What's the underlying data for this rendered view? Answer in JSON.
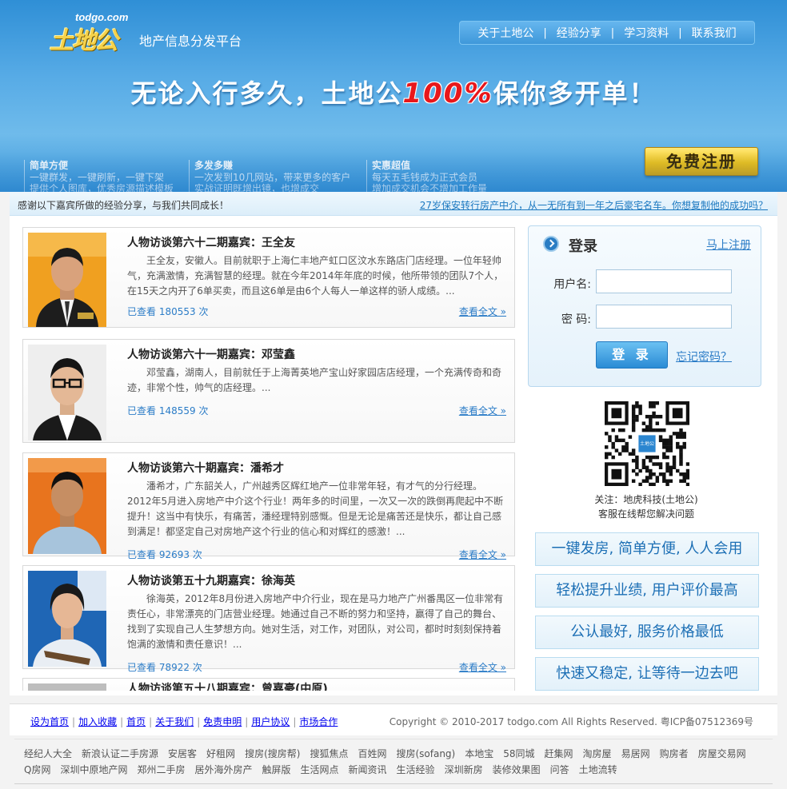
{
  "brand": {
    "domain": "todgo.com",
    "logo_text": "土地公",
    "tagline": "地产信息分发平台"
  },
  "nav": [
    "关于土地公",
    "经验分享",
    "学习资料",
    "联系我们"
  ],
  "slogan": {
    "before": "无论入行多久，土地公",
    "highlight": "100%",
    "after": "保你多开单！"
  },
  "signup_button": "免费注册",
  "features": [
    {
      "title": "简单方便",
      "lines": [
        "一键群发，一键刷新，一键下架",
        "提供个人图库，优秀房源描述模板"
      ]
    },
    {
      "title": "多发多赚",
      "lines": [
        "一次发到10几网站，带来更多的客户",
        "实战证明既增出镜，也增成交"
      ]
    },
    {
      "title": "实惠超值",
      "lines": [
        "每天五毛钱成为正式会员",
        "增加成交机会不增加工作量"
      ]
    }
  ],
  "infobar": {
    "left": "感谢以下嘉宾所做的经验分享，与我们共同成长！",
    "right": "27岁保安转行房产中介，从一无所有到一年之后豪宅名车。你想复制他的成功吗？"
  },
  "articles": [
    {
      "title": "人物访谈第六十二期嘉宾：王全友",
      "desc": "王全友，安徽人。目前就职于上海仁丰地产虹口区汶水东路店门店经理。一位年轻帅气，充满激情，充满智慧的经理。就在今年2014年年底的时候，他所带领的团队7个人，在15天之内开了6单买卖，而且这6单是由6个人每人一单这样的骄人成绩。...",
      "views_prefix": "已查看",
      "views": "180553",
      "views_suffix": "次",
      "more": "查看全文 »"
    },
    {
      "title": "人物访谈第六十一期嘉宾：邓莹鑫",
      "desc": "邓莹鑫，湖南人，目前就任于上海菁英地产宝山好家园店店经理，一个充满传奇和奇迹，非常个性，帅气的店经理。...",
      "views_prefix": "已查看",
      "views": "148559",
      "views_suffix": "次",
      "more": "查看全文 »"
    },
    {
      "title": "人物访谈第六十期嘉宾：潘希才",
      "desc": "潘希才，广东韶关人，广州越秀区辉红地产一位非常年轻，有才气的分行经理。2012年5月进入房地产中介这个行业！两年多的时间里，一次又一次的跌倒再爬起中不断提升！这当中有快乐，有痛苦，潘经理特别感慨。但是无论是痛苦还是快乐，都让自己感到满足！都坚定自己对房地产这个行业的信心和对辉红的感激！...",
      "views_prefix": "已查看",
      "views": "92693",
      "views_suffix": "次",
      "more": "查看全文 »"
    },
    {
      "title": "人物访谈第五十九期嘉宾：徐海英",
      "desc": "徐海英，2012年8月份进入房地产中介行业，现在是马力地产广州番禺区一位非常有责任心，非常漂亮的门店营业经理。她通过自己不断的努力和坚持，赢得了自己的舞台、找到了实现自己人生梦想方向。她对生活，对工作，对团队，对公司，都时时刻刻保持着饱满的激情和责任意识！...",
      "views_prefix": "已查看",
      "views": "78922",
      "views_suffix": "次",
      "more": "查看全文 »"
    },
    {
      "title": "人物访谈第五十八期嘉宾：曾嘉豪(中原)",
      "desc": "",
      "views_prefix": "",
      "views": "",
      "views_suffix": "",
      "more": ""
    }
  ],
  "login": {
    "heading": "登录",
    "register": "马上注册",
    "username_label": "用户名:",
    "password_label": "密  码:",
    "submit": "登 录",
    "forgot": "忘记密码？"
  },
  "qr_caption": [
    "关注：地虎科技(土地公)",
    "客服在线帮您解决问题"
  ],
  "qr_logo": "土地公",
  "promos": [
    "一键发房, 简单方便, 人人会用",
    "轻松提升业绩, 用户评价最高",
    "公认最好, 服务价格最低",
    "快速又稳定, 让等待一边去吧"
  ],
  "footer": {
    "links": [
      "设为首页",
      "加入收藏",
      "首页",
      "关于我们",
      "免责申明",
      "用户协议",
      "市场合作"
    ],
    "copyright": "Copyright © 2010-2017 todgo.com All Rights Reserved. 粤ICP备07512369号"
  },
  "friend_links": [
    "经纪人大全",
    "新浪认证二手房源",
    "安居客",
    "好租网",
    "搜房(搜房帮)",
    "搜狐焦点",
    "百姓网",
    "搜房(sofang)",
    "本地宝",
    "58同城",
    "赶集网",
    "淘房屋",
    "易居网",
    "购房者",
    "房屋交易网",
    "Q房网",
    "深圳中原地产网",
    "郑州二手房",
    "居外海外房产",
    "触屏版",
    "生活网点",
    "新闻资讯",
    "生活经验",
    "深圳新房",
    "装修效果图",
    "问答",
    "土地流转"
  ],
  "colors": {
    "header_blue": "#3d97d9",
    "link_blue": "#2b7cc7",
    "highlight_red": "#e8171b",
    "button_gold": "#f3c315"
  },
  "icons": [
    "arrow-circle-icon",
    "qr-code-icon"
  ]
}
